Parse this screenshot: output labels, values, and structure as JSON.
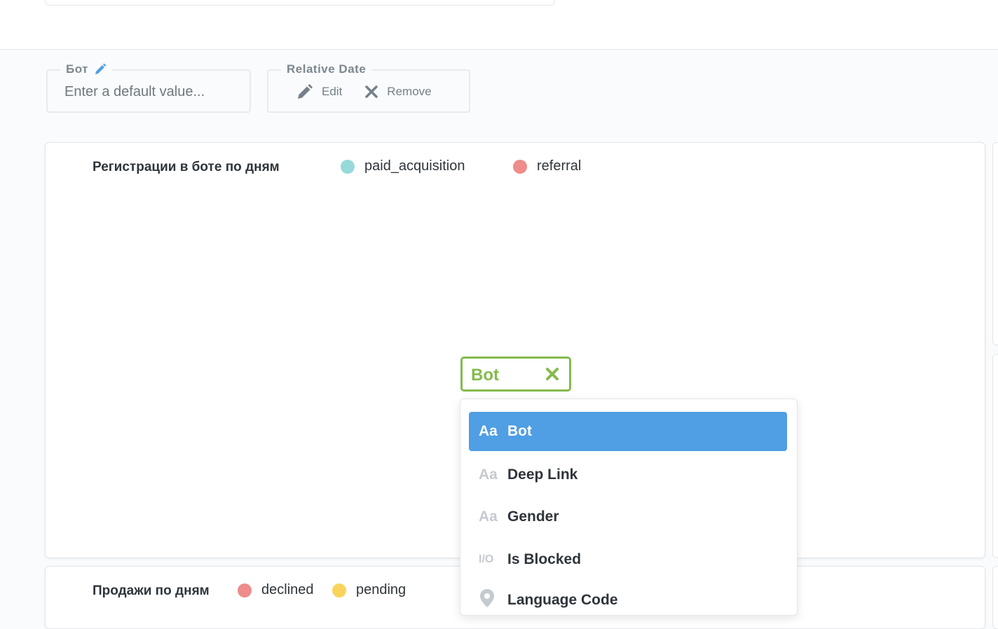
{
  "parameters": [
    {
      "name": "Бот",
      "placeholder": "Enter a default value..."
    },
    {
      "name": "Relative Date",
      "edit_label": "Edit",
      "remove_label": "Remove"
    }
  ],
  "cards": [
    {
      "title": "Регистрации в боте по дням",
      "legend": [
        {
          "label": "paid_acquisition",
          "color": "#98d9d9"
        },
        {
          "label": "referral",
          "color": "#ef8c8c"
        }
      ]
    },
    {
      "title": "Продажи по дням",
      "legend": [
        {
          "label": "declined",
          "color": "#ef8c8c"
        },
        {
          "label": "pending",
          "color": "#f9d45c"
        }
      ]
    }
  ],
  "mapping": {
    "selected_tag": "Bot",
    "accent": "#84bb4c",
    "options": [
      {
        "icon": "Aa",
        "icon_name": "text-type-icon",
        "label": "Bot",
        "active": true
      },
      {
        "icon": "Aa",
        "icon_name": "text-type-icon",
        "label": "Deep Link",
        "active": false
      },
      {
        "icon": "Aa",
        "icon_name": "text-type-icon",
        "label": "Gender",
        "active": false
      },
      {
        "icon": "I/O",
        "icon_name": "boolean-type-icon",
        "label": "Is Blocked",
        "active": false
      },
      {
        "icon": "",
        "icon_name": "location-pin-icon",
        "label": "Language Code",
        "active": false
      }
    ]
  },
  "colors": {
    "brand": "#509ee3",
    "text_dark": "#2e353b",
    "text_muted": "#74808a"
  }
}
